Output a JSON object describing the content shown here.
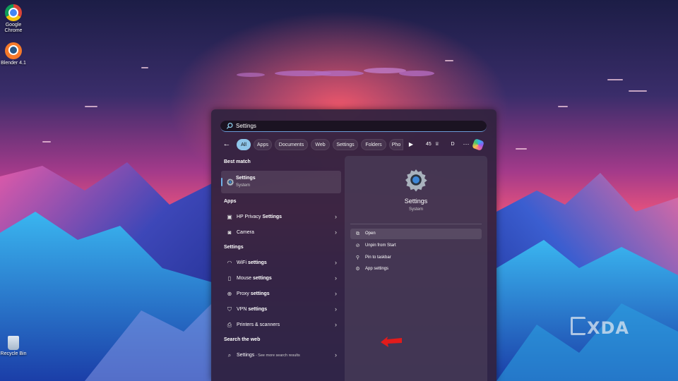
{
  "desktop": {
    "icons": [
      {
        "label": "Google Chrome",
        "icon": "chrome-icon"
      },
      {
        "label": "Blender 4.1",
        "icon": "blender-icon"
      },
      {
        "label": "Recycle Bin",
        "icon": "recycle-bin-icon"
      }
    ],
    "watermark": "XDA"
  },
  "search": {
    "value": "Settings",
    "icon": "search-icon"
  },
  "filters": {
    "back_icon": "arrow-left-icon",
    "chips": [
      "All",
      "Apps",
      "Documents",
      "Web",
      "Settings",
      "Folders",
      "Pho"
    ],
    "active": "All",
    "play_icon": "play-icon",
    "points": "45",
    "points_icon": "rewards-icon",
    "avatar": "D",
    "more": "···",
    "copilot_icon": "copilot-icon"
  },
  "results": {
    "best_match_heading": "Best match",
    "best_match": {
      "title": "Settings",
      "subtitle": "System",
      "icon": "settings-gear-icon"
    },
    "apps_heading": "Apps",
    "apps": [
      {
        "prefix": "HP Privacy ",
        "bold": "Settings",
        "icon": "hp-privacy-icon"
      },
      {
        "prefix": "Camera",
        "bold": "",
        "icon": "camera-icon"
      }
    ],
    "settings_heading": "Settings",
    "settings": [
      {
        "prefix": "WiFi ",
        "bold": "settings",
        "icon": "wifi-icon"
      },
      {
        "prefix": "Mouse ",
        "bold": "settings",
        "icon": "mouse-icon"
      },
      {
        "prefix": "Proxy ",
        "bold": "settings",
        "icon": "globe-icon"
      },
      {
        "prefix": "VPN ",
        "bold": "settings",
        "icon": "shield-icon"
      },
      {
        "prefix": "Printers & scanners",
        "bold": "",
        "icon": "printer-icon"
      }
    ],
    "web_heading": "Search the web",
    "web": {
      "bold": "Settings",
      "suffix": " - See more search results",
      "icon": "search-icon"
    }
  },
  "preview": {
    "title": "Settings",
    "subtitle": "System",
    "actions": [
      {
        "label": "Open",
        "icon": "open-external-icon"
      },
      {
        "label": "Unpin from Start",
        "icon": "unpin-icon"
      },
      {
        "label": "Pin to taskbar",
        "icon": "pin-icon"
      },
      {
        "label": "App settings",
        "icon": "gear-icon"
      }
    ]
  },
  "colors": {
    "accent": "#8fc6ea",
    "annotation_arrow": "#e21b1b"
  }
}
